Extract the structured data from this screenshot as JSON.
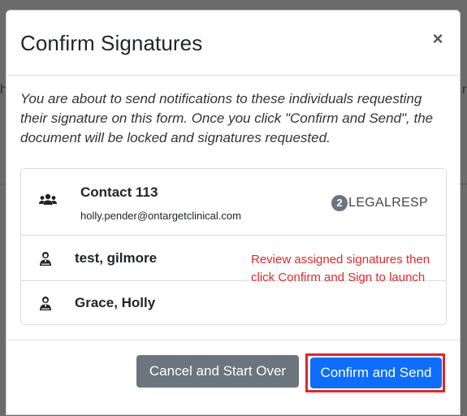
{
  "backdrop": {
    "left_char": "h",
    "right_char": "r"
  },
  "modal": {
    "title": "Confirm Signatures",
    "close_label": "×",
    "intro_text": "You are about to send notifications to these individuals requesting their signature on this form. Once you click \"Confirm and Send\", the document will be locked and signatures requested."
  },
  "signers": [
    {
      "name": "Contact 113",
      "email": "holly.pender@ontargetclinical.com",
      "icon": "group-icon",
      "badge_count": "2",
      "role": "LEGALRESP"
    },
    {
      "name": "test, gilmore",
      "icon": "user-tie-icon"
    },
    {
      "name": "Grace, Holly",
      "icon": "user-tie-icon"
    }
  ],
  "annotation": {
    "text": "Review assigned signatures then click Confirm and Sign to launch",
    "color": "#e8262b"
  },
  "footer": {
    "cancel_label": "Cancel and Start Over",
    "confirm_label": "Confirm and Send"
  },
  "colors": {
    "primary": "#0d6efd",
    "secondary": "#6c757d",
    "highlight": "#e0242b"
  }
}
